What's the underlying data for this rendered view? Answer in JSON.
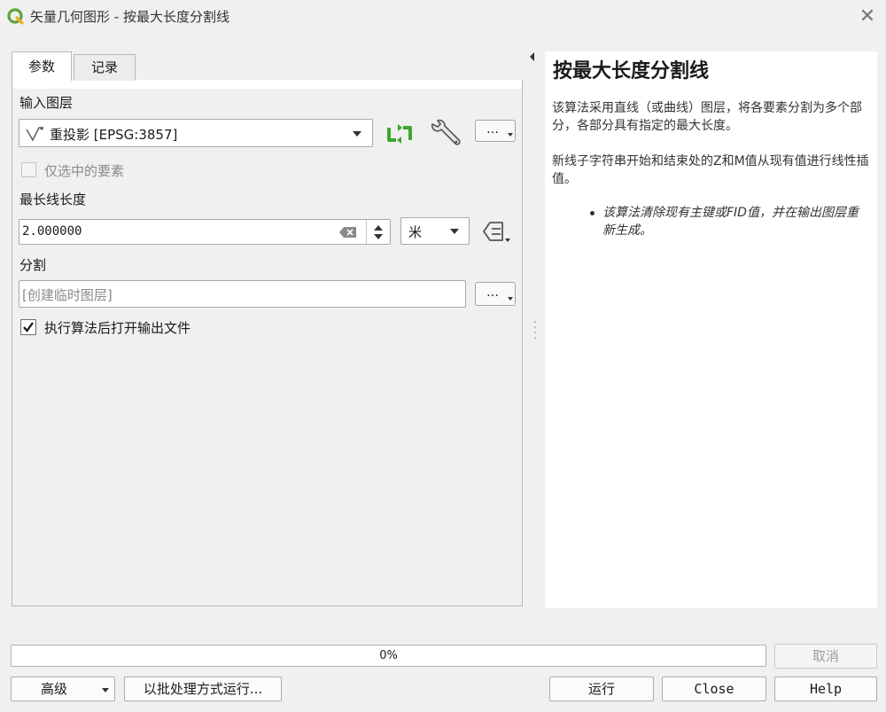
{
  "window": {
    "title": "矢量几何图形 - 按最大长度分割线",
    "close_glyph": "✕"
  },
  "tabs": [
    {
      "label": "参数"
    },
    {
      "label": "记录"
    }
  ],
  "params": {
    "input_layer": {
      "label": "输入图层",
      "value": "重投影 [EPSG:3857]",
      "more": "…"
    },
    "selected_only": {
      "label": "仅选中的要素",
      "checked": false
    },
    "max_length": {
      "label": "最长线长度",
      "value": "2.000000",
      "unit": "米"
    },
    "split": {
      "label": "分割",
      "placeholder": "[创建临时图层]",
      "more": "…"
    },
    "open_output": {
      "label": "执行算法后打开输出文件",
      "checked": true
    }
  },
  "help": {
    "title": "按最大长度分割线",
    "p1": "该算法采用直线（或曲线）图层，将各要素分割为多个部分，各部分具有指定的最大长度。",
    "p2": "新线子字符串开始和结束处的Z和M值从现有值进行线性插值。",
    "bullet": "该算法清除现有主键或FID值，并在输出图层重新生成。"
  },
  "progress": {
    "value": 0,
    "text": "0%"
  },
  "buttons": {
    "cancel": "取消",
    "advanced": "高级",
    "batch": "以批处理方式运行...",
    "run": "运行",
    "close": "Close",
    "help": "Help"
  },
  "colors": {
    "accent_green": "#41a32d",
    "qgis_icon": "#3d9a3a"
  }
}
